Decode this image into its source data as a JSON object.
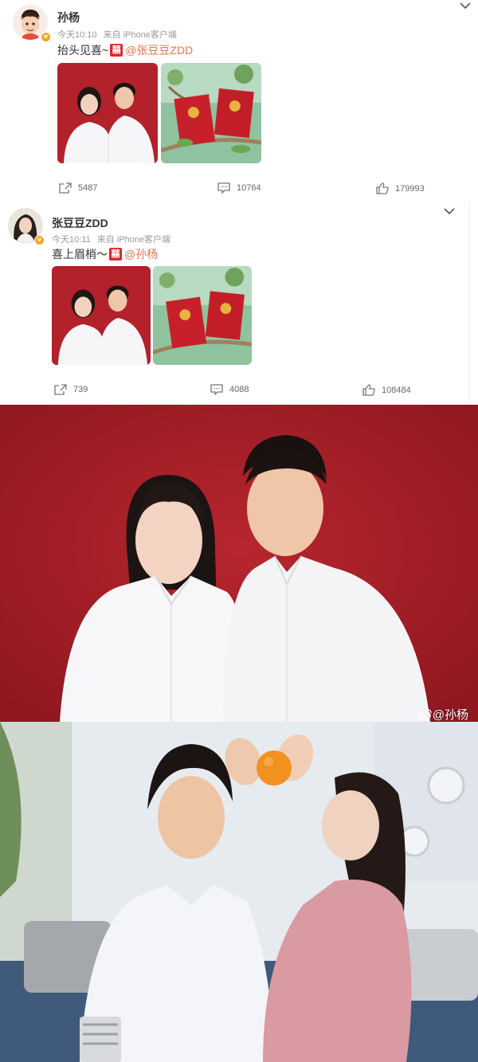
{
  "posts": [
    {
      "author": "孙杨",
      "time": "今天10:10",
      "source": "来自 iPhone客户端",
      "text": "抬头见喜~",
      "mention": "@张豆豆ZDD",
      "reposts": "5487",
      "comments": "10764",
      "likes": "179993"
    },
    {
      "author": "张豆豆ZDD",
      "time": "今天10:11",
      "source": "来自 iPhone客户端",
      "text": "喜上眉梢～",
      "mention": "@孙杨",
      "reposts": "739",
      "comments": "4088",
      "likes": "108484"
    }
  ],
  "badges": {
    "verified": "v",
    "double_happiness": "囍"
  },
  "watermark": "@孙杨",
  "icons": [
    "chevron-down-icon",
    "share-icon",
    "comment-icon",
    "like-icon",
    "weibo-logo-icon"
  ],
  "colors": {
    "mention": "#eb7350",
    "verified": "#f6a623",
    "red_background": "#a81c22"
  }
}
